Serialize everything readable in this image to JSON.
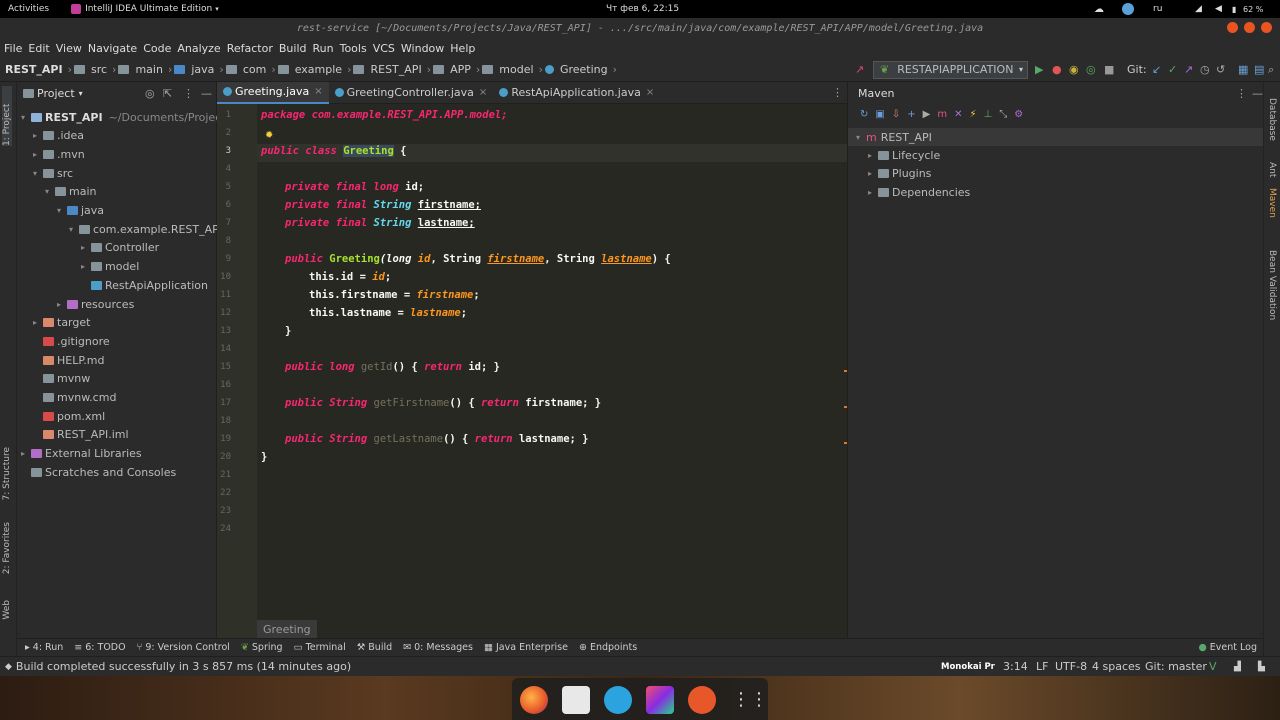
{
  "gnome": {
    "activities": "Activities",
    "app": "IntelliJ IDEA Ultimate Edition",
    "clock": "Чт фев 6, 22:15",
    "lang": "ru",
    "battery": "62 %"
  },
  "window": {
    "title": "rest-service [~/Documents/Projects/Java/REST_API] - .../src/main/java/com/example/REST_API/APP/model/Greeting.java"
  },
  "menu": [
    "File",
    "Edit",
    "View",
    "Navigate",
    "Code",
    "Analyze",
    "Refactor",
    "Build",
    "Run",
    "Tools",
    "VCS",
    "Window",
    "Help"
  ],
  "breadcrumbs": [
    "REST_API",
    "src",
    "main",
    "java",
    "com",
    "example",
    "REST_API",
    "APP",
    "model",
    "Greeting"
  ],
  "run_config": "RESTAPIAPPLICATION",
  "git_label": "Git:",
  "project": {
    "title": "Project",
    "tree": [
      {
        "label": "REST_API",
        "extra": "~/Documents/Projects/",
        "depth": 0,
        "expanded": true,
        "color": "#8fb2d9"
      },
      {
        "label": ".idea",
        "depth": 1,
        "expanded": false,
        "color": "#87939a"
      },
      {
        "label": ".mvn",
        "depth": 1,
        "expanded": false,
        "color": "#87939a"
      },
      {
        "label": "src",
        "depth": 1,
        "expanded": true,
        "color": "#87939a"
      },
      {
        "label": "main",
        "depth": 2,
        "expanded": true,
        "color": "#87939a"
      },
      {
        "label": "java",
        "depth": 3,
        "expanded": true,
        "color": "#4a88c7"
      },
      {
        "label": "com.example.REST_API.A",
        "depth": 4,
        "expanded": true,
        "color": "#87939a"
      },
      {
        "label": "Controller",
        "depth": 5,
        "expanded": false,
        "color": "#87939a"
      },
      {
        "label": "model",
        "depth": 5,
        "expanded": false,
        "color": "#87939a"
      },
      {
        "label": "RestApiApplication",
        "depth": 5,
        "leaf": true,
        "color": "#4a9ec7"
      },
      {
        "label": "resources",
        "depth": 3,
        "expanded": false,
        "color": "#b26ec7"
      },
      {
        "label": "target",
        "depth": 1,
        "expanded": false,
        "color": "#d9896b"
      },
      {
        "label": ".gitignore",
        "depth": 1,
        "leaf": true,
        "color": "#d94b4b"
      },
      {
        "label": "HELP.md",
        "depth": 1,
        "leaf": true,
        "color": "#d9896b"
      },
      {
        "label": "mvnw",
        "depth": 1,
        "leaf": true,
        "color": "#87939a"
      },
      {
        "label": "mvnw.cmd",
        "depth": 1,
        "leaf": true,
        "color": "#87939a"
      },
      {
        "label": "pom.xml",
        "depth": 1,
        "leaf": true,
        "color": "#d94b4b"
      },
      {
        "label": "REST_API.iml",
        "depth": 1,
        "leaf": true,
        "color": "#d9896b"
      },
      {
        "label": "External Libraries",
        "depth": 0,
        "expanded": false,
        "color": "#b26ec7"
      },
      {
        "label": "Scratches and Consoles",
        "depth": 0,
        "leaf": true,
        "color": "#87939a"
      }
    ]
  },
  "tabs": [
    {
      "label": "Greeting.java",
      "active": true
    },
    {
      "label": "GreetingController.java",
      "active": false
    },
    {
      "label": "RestApiApplication.java",
      "active": false
    }
  ],
  "editor": {
    "lines": [
      "1",
      "2",
      "3",
      "4",
      "5",
      "6",
      "7",
      "8",
      "9",
      "10",
      "11",
      "12",
      "13",
      "14",
      "15",
      "16",
      "17",
      "18",
      "19",
      "20",
      "21",
      "22",
      "23",
      "24"
    ],
    "crumb": "Greeting",
    "code": {
      "l1": "package com.example.REST_API.APP.model;",
      "l3_kw": "public class ",
      "l3_cls": "Greeting",
      "l3_end": " {",
      "l5": "id;",
      "l6": "firstname;",
      "l7": "lastname;",
      "priv_final": "private final ",
      "long": "long ",
      "string": "String ",
      "l9_pub": "public ",
      "l9_fn": "Greeting",
      "l9_a": "(long ",
      "l9_b": "id",
      "l9_c": ", String ",
      "l9_d": "firstname",
      "l9_e": ", String ",
      "l9_f": "lastname",
      "l9_g": ") {",
      "l10_a": "this.",
      "l10_b": "id = ",
      "l10_c": "id",
      "l10_d": ";",
      "l11_b": "firstname = ",
      "l11_c": "firstname",
      "l12_b": "lastname = ",
      "l12_c": "lastname",
      "l13": "}",
      "l15_a": "public long ",
      "l15_b": "getId",
      "l15_c": "() { ",
      "l15_d": "return ",
      "l15_e": "id; }",
      "l19_a": "public String ",
      "l19_b": "getFirstname",
      "l19_c": "() { ",
      "l19_d": "return ",
      "l19_e": "firstname; }",
      "l23_a": "public String ",
      "l23_b": "getLastname",
      "l23_c": "() { ",
      "l23_d": "return ",
      "l23_e": "lastname; }",
      "l24": "}"
    }
  },
  "maven": {
    "title": "Maven",
    "root": "REST_API",
    "items": [
      "Lifecycle",
      "Plugins",
      "Dependencies"
    ]
  },
  "left_tabs": [
    "1: Project",
    "7: Structure",
    "2: Favorites",
    "Web"
  ],
  "right_tabs": [
    "Database",
    "Ant",
    "Maven",
    "Bean Validation"
  ],
  "tool_windows": [
    "4: Run",
    "6: TODO",
    "9: Version Control",
    "Spring",
    "Terminal",
    "Build",
    "0: Messages",
    "Java Enterprise",
    "Endpoints"
  ],
  "event_log": "Event Log",
  "status": {
    "message": "Build completed successfully in 3 s 857 ms (14 minutes ago)",
    "theme": "Monokai Pr",
    "position": "3:14",
    "line_sep": "LF",
    "encoding": "UTF-8",
    "indent": "4 spaces",
    "branch": "Git: master"
  },
  "colors": {
    "accent": "#4a88c7",
    "keyword": "#f92672",
    "type": "#66d9ef",
    "function": "#a6e22e",
    "param": "#fd971f"
  }
}
